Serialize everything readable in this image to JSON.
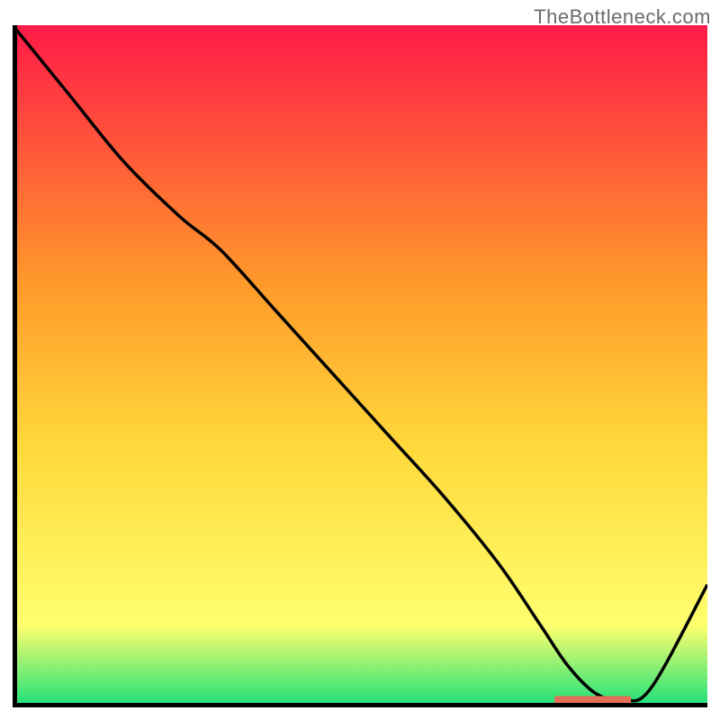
{
  "watermark": {
    "text": "TheBottleneck.com"
  },
  "chart_data": {
    "type": "line",
    "title": "",
    "xlabel": "",
    "ylabel": "",
    "xlim": [
      0,
      100
    ],
    "ylim": [
      0,
      100
    ],
    "grid": false,
    "legend": false,
    "annotations": [],
    "background_gradient": {
      "top_color": "#ff1a47",
      "mid_upper_color": "#ff9a2a",
      "mid_color": "#ffd93b",
      "mid_lower_color": "#ffff6e",
      "bottom_color": "#19e07a"
    },
    "series": [
      {
        "name": "curve",
        "color": "#000000",
        "x": [
          0,
          8,
          16,
          24,
          30,
          38,
          46,
          54,
          62,
          70,
          76,
          80,
          84,
          88,
          92,
          100
        ],
        "y": [
          100,
          90,
          80,
          72,
          67,
          58,
          49,
          40,
          31,
          21,
          12,
          6,
          2,
          1,
          3,
          18
        ]
      }
    ],
    "bottom_marker": {
      "color": "#e36f57",
      "x_start": 78,
      "x_end": 89,
      "y": 1
    },
    "axes": {
      "left": true,
      "bottom": true,
      "top": false,
      "right": false,
      "color": "#000000",
      "width": 5
    }
  }
}
